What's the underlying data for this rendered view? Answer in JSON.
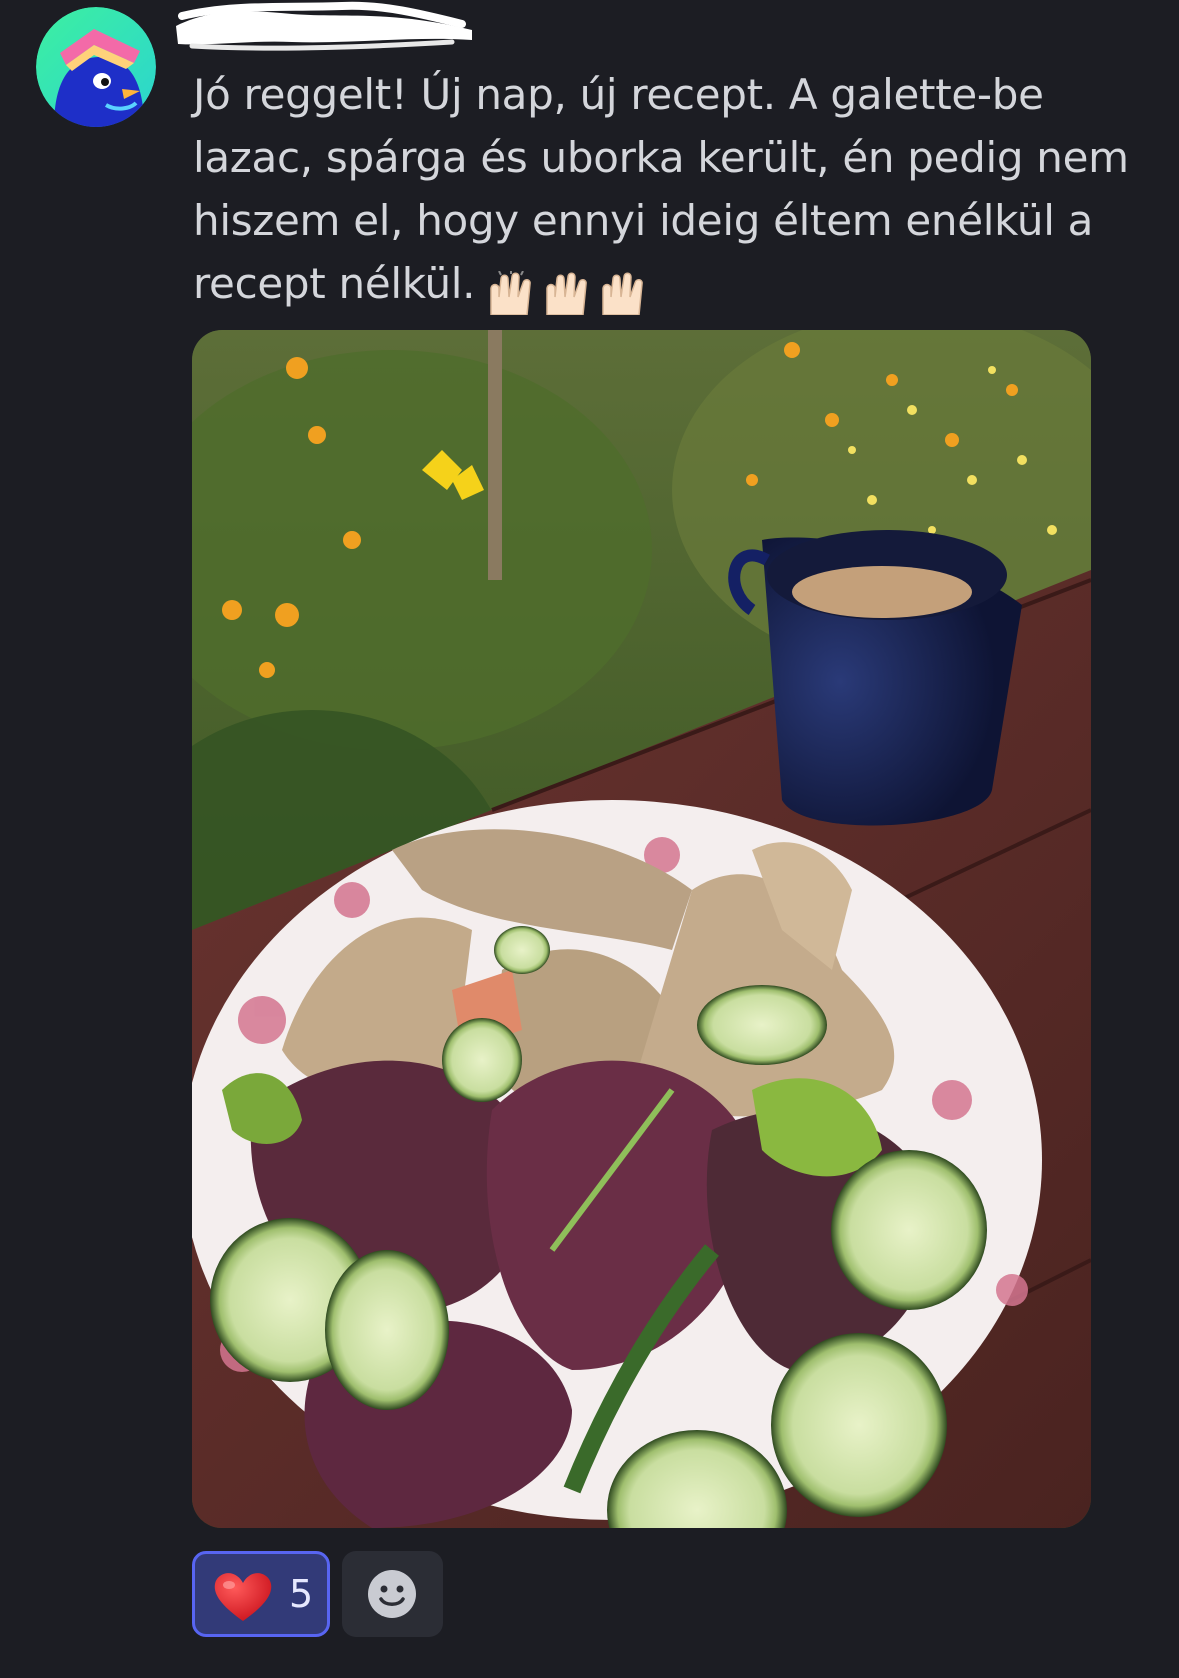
{
  "message": {
    "author_redacted": true,
    "text": "Jó reggelt! Új nap, új recept. A galette-be lazac, spárga és uborka került, én pedig nem hiszem el, hogy ennyi ideig éltem enélkül a recept nélkül.",
    "emojis": [
      "raising-hands-emoji",
      "raising-hands-emoji",
      "raising-hands-emoji"
    ]
  },
  "attachment": {
    "type": "photo"
  },
  "reactions": [
    {
      "emoji": "heart-emoji",
      "count": "5",
      "active": true
    }
  ],
  "add_reaction": {
    "icon": "smiley-add-reaction-icon"
  },
  "colors": {
    "background": "#1c1d23",
    "text": "#d4d6db",
    "reaction_active_bg": "#323a78",
    "reaction_active_border": "#5865f2"
  }
}
